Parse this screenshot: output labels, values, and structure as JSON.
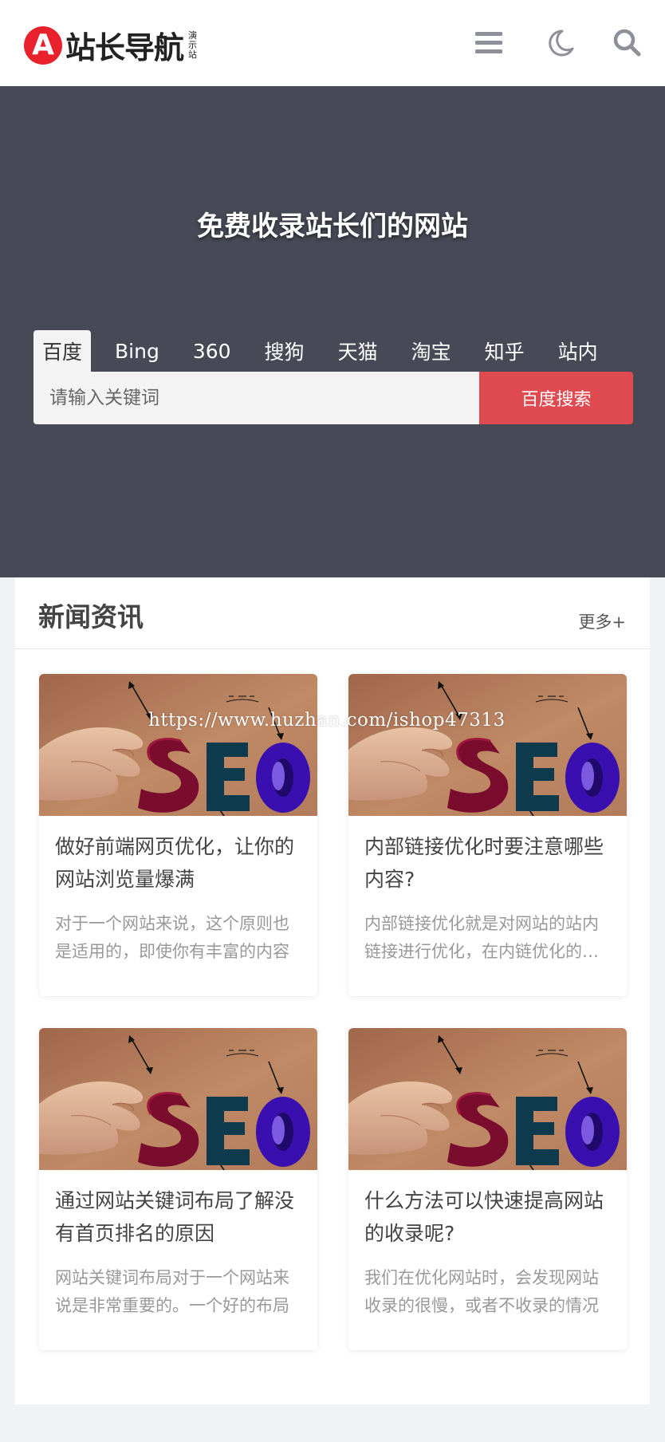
{
  "header": {
    "logo_letter": "A",
    "logo_title": "站长导航",
    "logo_sub": "演示站",
    "icons": [
      "menu-icon",
      "moon-icon",
      "search-icon"
    ],
    "accent_color": "#e8212c"
  },
  "hero": {
    "title": "免费收录站长们的网站",
    "tabs": [
      "百度",
      "Bing",
      "360",
      "搜狗",
      "天猫",
      "淘宝",
      "知乎",
      "站内"
    ],
    "active_tab": "百度",
    "search_placeholder": "请输入关键词",
    "search_button": "百度搜索",
    "background_color": "#474a56",
    "button_color": "#df4b50"
  },
  "news": {
    "title": "新闻资讯",
    "more": "更多+",
    "watermark": "https://www.huzhan.com/ishop47313",
    "articles": [
      {
        "title": "做好前端网页优化，让你的网站浏览量爆满",
        "desc": "对于一个网站来说，这个原则也是适用的，即使你有丰富的内容"
      },
      {
        "title": "内部链接优化时要注意哪些内容?",
        "desc": "内部链接优化就是对网站的站内链接进行优化，在内链优化的时候"
      },
      {
        "title": "通过网站关键词布局了解没有首页排名的原因",
        "desc": "网站关键词布局对于一个网站来说是非常重要的。一个好的布局"
      },
      {
        "title": "什么方法可以快速提高网站的收录呢?",
        "desc": "我们在优化网站时，会发现网站收录的很慢，或者不收录的情况"
      }
    ]
  }
}
